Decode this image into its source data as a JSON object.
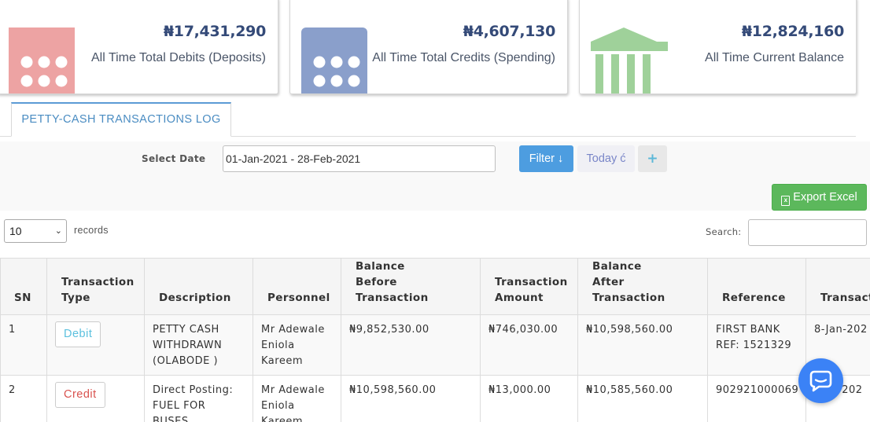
{
  "stats": [
    {
      "amount": "₦17,431,290",
      "caption": "All Time Total Debits (Deposits)",
      "icon": "calculator-icon",
      "color": "#eda3a3"
    },
    {
      "amount": "₦4,607,130",
      "caption": "All Time Total Credits (Spending)",
      "icon": "calculator-icon",
      "color": "#8a9fcb"
    },
    {
      "amount": "₦12,824,160",
      "caption": "All Time Current Balance",
      "icon": "bank-icon",
      "color": "#9fd19a"
    }
  ],
  "tab": {
    "label": "PETTY-CASH TRANSACTIONS LOG"
  },
  "filter": {
    "select_date_label": "Select Date",
    "date_range": "01-Jan-2021 - 28-Feb-2021",
    "filter_button": "Filter ↓",
    "today_button": "Today ć",
    "add_button": "+",
    "export_button": "Export Excel"
  },
  "records": {
    "page_size": "10",
    "label": "records",
    "search_label": "Search:"
  },
  "table": {
    "headers": {
      "sn": "SN",
      "type": [
        "Transaction",
        "Type"
      ],
      "description": "Description",
      "personnel": "Personnel",
      "before": [
        "Balance",
        "Before Transaction"
      ],
      "amount": [
        "Transaction",
        "Amount"
      ],
      "after": [
        "Balance",
        "After Transaction"
      ],
      "reference": "Reference",
      "date": "Transact"
    },
    "rows": [
      {
        "sn": "1",
        "type": "Debit",
        "description": [
          "PETTY CASH",
          "WITHDRAWN",
          "(OLABODE )"
        ],
        "personnel": [
          "Mr Adewale",
          "Eniola",
          "Kareem"
        ],
        "before": "₦9,852,530.00",
        "amount": "₦746,030.00",
        "after": "₦10,598,560.00",
        "reference": [
          "FIRST BANK",
          "REF: 1521329"
        ],
        "date": "8-Jan-202"
      },
      {
        "sn": "2",
        "type": "Credit",
        "description": [
          "Direct Posting:",
          "FUEL FOR",
          "BUSES"
        ],
        "personnel": [
          "Mr Adewale",
          "Eniola",
          "Kareem"
        ],
        "before": "₦10,598,560.00",
        "amount": "₦13,000.00",
        "after": "₦10,585,560.00",
        "reference": [
          "902921000069"
        ],
        "date": "-202"
      }
    ]
  },
  "colors": {
    "accent": "#4d9de0",
    "success": "#5cb85c",
    "debit": "#5bc0de",
    "credit": "#d9534f",
    "chat": "#3b82f6"
  }
}
